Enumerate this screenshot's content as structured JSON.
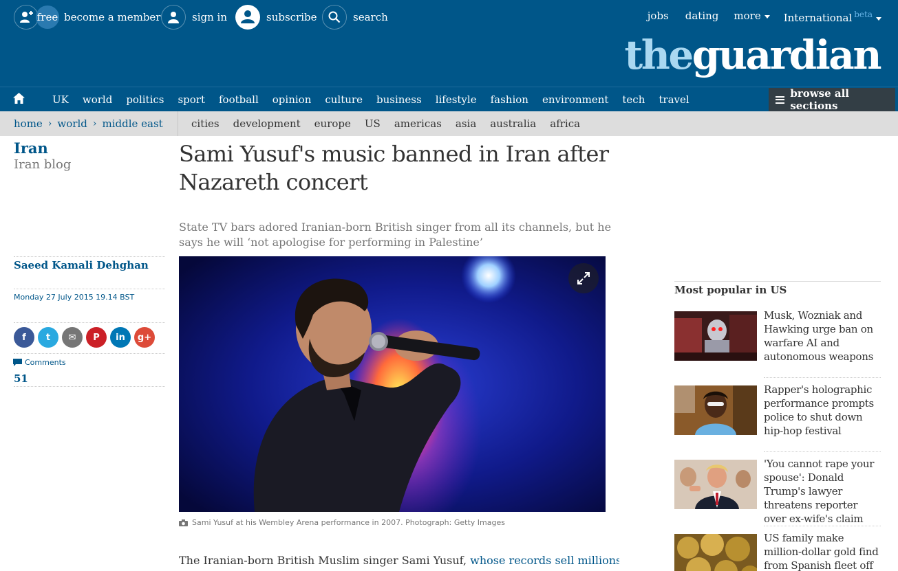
{
  "topbar": {
    "free_label": "free",
    "member_label": "become a member",
    "signin_label": "sign in",
    "subscribe_label": "subscribe",
    "search_label": "search",
    "right_links": [
      "jobs",
      "dating",
      "more",
      "International"
    ],
    "beta_label": "beta"
  },
  "logo": {
    "part1": "the",
    "part2": "guardian"
  },
  "pillars": [
    "UK",
    "world",
    "politics",
    "sport",
    "football",
    "opinion",
    "culture",
    "business",
    "lifestyle",
    "fashion",
    "environment",
    "tech",
    "travel"
  ],
  "browse_label": "browse all sections",
  "breadcrumbs": [
    "home",
    "world",
    "middle east"
  ],
  "subnav": [
    "cities",
    "development",
    "europe",
    "US",
    "americas",
    "asia",
    "australia",
    "africa"
  ],
  "series": {
    "title": "Iran",
    "subtitle": "Iran blog"
  },
  "article": {
    "headline": "Sami Yusuf's music banned in Iran after Nazareth concert",
    "standfirst": "State TV bars adored Iranian-born British singer from all its channels, but he says he will ‘not apologise for performing in Palestine’",
    "byline": "Saeed Kamali Dehghan",
    "dateline": "Monday 27 July 2015 19.14 BST",
    "caption": "Sami Yusuf at his Wembley Arena performance in 2007. Photograph: Getty Images",
    "body_start": "The Iranian-born British Muslim singer Sami Yusuf, ",
    "body_link": "whose records sell millions in"
  },
  "share_buttons": [
    {
      "name": "facebook",
      "glyph": "f",
      "color": "#3b5998"
    },
    {
      "name": "twitter",
      "glyph": "t",
      "color": "#2aa9e0"
    },
    {
      "name": "email",
      "glyph": "✉",
      "color": "#767676"
    },
    {
      "name": "pinterest",
      "glyph": "P",
      "color": "#cb2027"
    },
    {
      "name": "linkedin",
      "glyph": "in",
      "color": "#0077b5"
    },
    {
      "name": "googleplus",
      "glyph": "g+",
      "color": "#dd4b39"
    }
  ],
  "comments": {
    "label": "Comments",
    "count": "51"
  },
  "most_popular": {
    "title": "Most popular in US",
    "items": [
      "Musk, Wozniak and Hawking urge ban on warfare AI and autonomous weapons",
      "Rapper's holographic performance prompts police to shut down hip-hop festival",
      "'You cannot rape your spouse': Donald Trump's lawyer threatens reporter over ex-wife's claim",
      "US family make million-dollar gold find from Spanish fleet off Florida"
    ]
  },
  "colors": {
    "brand": "#005689",
    "logo_light": "#aad8f1",
    "browse_bg": "#333e45",
    "subnav_bg": "#dddddd"
  }
}
